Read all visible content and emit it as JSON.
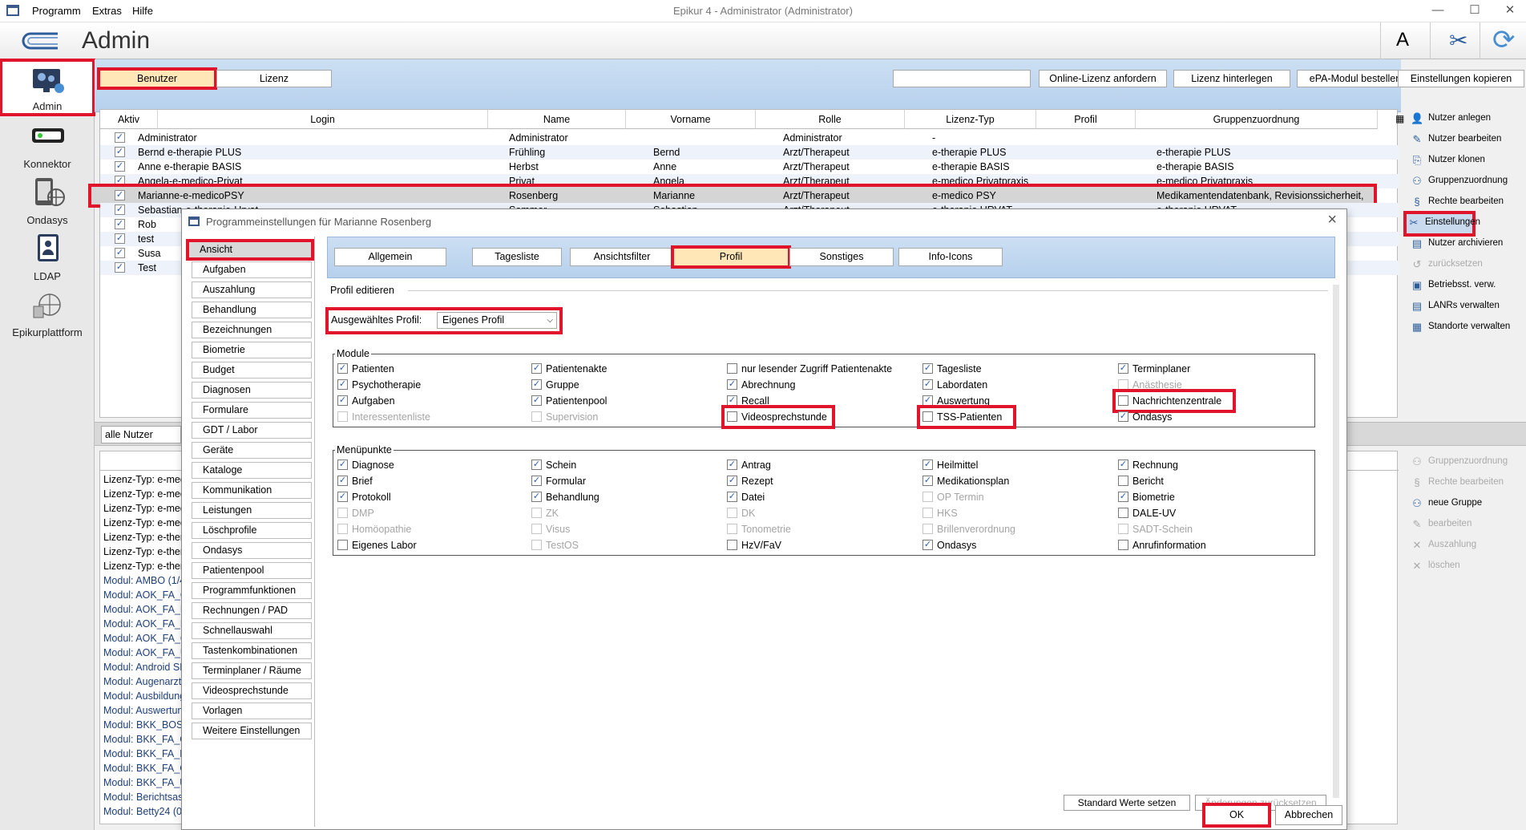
{
  "window": {
    "title": "Epikur 4 - Administrator (Administrator)",
    "menu": [
      "Programm",
      "Extras",
      "Hilfe"
    ]
  },
  "header": {
    "title": "Admin",
    "font_button": "A"
  },
  "nav": {
    "items": [
      {
        "label": "Admin",
        "icon": "admin-icon"
      },
      {
        "label": "Konnektor",
        "icon": "konnektor-icon"
      },
      {
        "label": "Ondasys",
        "icon": "ondasys-icon"
      },
      {
        "label": "LDAP",
        "icon": "ldap-icon"
      },
      {
        "label": "Epikurplattform",
        "icon": "platform-icon"
      }
    ]
  },
  "toolbar": {
    "tab_benutzer": "Benutzer",
    "tab_lizenz": "Lizenz",
    "search_value": "",
    "buttons": [
      "Online-Lizenz anfordern",
      "Lizenz hinterlegen",
      "ePA-Modul bestellen",
      "Einstellungen kopieren"
    ]
  },
  "table": {
    "columns": [
      "Aktiv",
      "Login",
      "Name",
      "Vorname",
      "Rolle",
      "Lizenz-Typ",
      "Profil",
      "Gruppenzuordnung"
    ],
    "rows": [
      {
        "login": "Administrator",
        "name": "Administrator",
        "vorname": "",
        "rolle": "Administrator",
        "lizenz": "-",
        "profil": "",
        "gruppe": ""
      },
      {
        "login": "Bernd e-therapie PLUS",
        "name": "Frühling",
        "vorname": "Bernd",
        "rolle": "Arzt/Therapeut",
        "lizenz": "e-therapie PLUS",
        "profil": "",
        "gruppe": "e-therapie PLUS"
      },
      {
        "login": "Anne e-therapie BASIS",
        "name": "Herbst",
        "vorname": "Anne",
        "rolle": "Arzt/Therapeut",
        "lizenz": "e-therapie BASIS",
        "profil": "",
        "gruppe": "e-therapie BASIS"
      },
      {
        "login": "Angela-e-medico-Privat",
        "name": "Privat",
        "vorname": "Angela",
        "rolle": "Arzt/Therapeut",
        "lizenz": "e-medico Privatpraxis",
        "profil": "",
        "gruppe": "e-medico Privatpraxis"
      },
      {
        "login": "Marianne-e-medicoPSY",
        "name": "Rosenberg",
        "vorname": "Marianne",
        "rolle": "Arzt/Therapeut",
        "lizenz": "e-medico PSY",
        "profil": "",
        "gruppe": "Medikamentendatenbank, Revisionssicherheit,"
      },
      {
        "login": "Sebastian-e-therapie-Urvat",
        "name": "Sommer",
        "vorname": "Sebastian",
        "rolle": "Arzt/Therapeut",
        "lizenz": "e-therapie URVAT",
        "profil": "",
        "gruppe": "e-therapie URVAT"
      },
      {
        "login": "Rob",
        "name": "",
        "vorname": "",
        "rolle": "",
        "lizenz": "",
        "profil": "",
        "gruppe": ""
      },
      {
        "login": "test",
        "name": "",
        "vorname": "",
        "rolle": "",
        "lizenz": "",
        "profil": "",
        "gruppe": ""
      },
      {
        "login": "Susa",
        "name": "",
        "vorname": "",
        "rolle": "",
        "lizenz": "",
        "profil": "",
        "gruppe": ""
      },
      {
        "login": "Test",
        "name": "",
        "vorname": "",
        "rolle": "",
        "lizenz": "",
        "profil": "",
        "gruppe": ""
      }
    ]
  },
  "actions": [
    {
      "label": "Nutzer anlegen",
      "icon": "user-add-icon",
      "enabled": true
    },
    {
      "label": "Nutzer bearbeiten",
      "icon": "user-edit-icon",
      "enabled": true
    },
    {
      "label": "Nutzer klonen",
      "icon": "user-clone-icon",
      "enabled": true
    },
    {
      "label": "Gruppenzuordnung",
      "icon": "group-icon",
      "enabled": true
    },
    {
      "label": "Rechte bearbeiten",
      "icon": "paragraph-icon",
      "enabled": true
    },
    {
      "label": "Einstellungen",
      "icon": "settings-icon",
      "enabled": true
    },
    {
      "label": "Nutzer archivieren",
      "icon": "archive-icon",
      "enabled": true
    },
    {
      "label": "zurücksetzen",
      "icon": "reset-icon",
      "enabled": false
    },
    {
      "label": "Betriebsst. verw.",
      "icon": "bsnr-icon",
      "enabled": true
    },
    {
      "label": "LANRs verwalten",
      "icon": "lanr-icon",
      "enabled": true
    },
    {
      "label": "Standorte verwalten",
      "icon": "location-icon",
      "enabled": true
    }
  ],
  "actions2": [
    {
      "label": "Gruppenzuordnung",
      "icon": "group-icon",
      "enabled": false
    },
    {
      "label": "Rechte bearbeiten",
      "icon": "paragraph-icon",
      "enabled": false
    },
    {
      "label": "neue Gruppe",
      "icon": "new-group-icon",
      "enabled": true
    },
    {
      "label": "bearbeiten",
      "icon": "edit-icon",
      "enabled": false
    },
    {
      "label": "Auszahlung",
      "icon": "payout-icon",
      "enabled": false
    },
    {
      "label": "löschen",
      "icon": "delete-icon",
      "enabled": false
    }
  ],
  "filter": {
    "value": "alle Nutzer"
  },
  "lower_list": [
    "Lizenz-Typ: e-med",
    "Lizenz-Typ: e-med",
    "Lizenz-Typ: e-med",
    "Lizenz-Typ: e-med",
    "Lizenz-Typ: e-thera",
    "Lizenz-Typ: e-thera",
    "Lizenz-Typ: e-thera",
    "Modul: AMBO (1/4(",
    "Modul: AOK_FA_G",
    "Modul: AOK_FA_K",
    "Modul: AOK_FA_N",
    "Modul: AOK_FA_C",
    "Modul: AOK_FA_U",
    "Modul: Android SM",
    "Modul: Augenarzt (",
    "Modul: Ausbildung",
    "Modul: Auswertun",
    "Modul: BKK_BOS(",
    "Modul: BKK_FA_G",
    "Modul: BKK_FA_K",
    "Modul: BKK_FA_C",
    "Modul: BKK_FA_U",
    "Modul: Berichtsas",
    "Modul: Betty24 (0/"
  ],
  "dialog": {
    "title": "Programmeinstellungen für Marianne Rosenberg",
    "categories": [
      "Ansicht",
      "Aufgaben",
      "Auszahlung",
      "Behandlung",
      "Bezeichnungen",
      "Biometrie",
      "Budget",
      "Diagnosen",
      "Formulare",
      "GDT / Labor",
      "Geräte",
      "Kataloge",
      "Kommunikation",
      "Leistungen",
      "Löschprofile",
      "Ondasys",
      "Patientenpool",
      "Programmfunktionen",
      "Rechnungen / PAD",
      "Schnellauswahl",
      "Tastenkombinationen",
      "Terminplaner / Räume",
      "Videosprechstunde",
      "Vorlagen",
      "Weitere Einstellungen"
    ],
    "tabs": [
      "Allgemein",
      "Tagesliste",
      "Ansichtsfilter",
      "Profil",
      "Sonstiges",
      "Info-Icons"
    ],
    "section_title": "Profil editieren",
    "profile_label": "Ausgewähltes Profil:",
    "profile_value": "Eigenes Profil",
    "modules_title": "Module",
    "modules": [
      [
        {
          "label": "Patienten",
          "checked": true,
          "enabled": true
        },
        {
          "label": "Psychotherapie",
          "checked": true,
          "enabled": true
        },
        {
          "label": "Aufgaben",
          "checked": true,
          "enabled": true
        },
        {
          "label": "Interessentenliste",
          "checked": false,
          "enabled": false
        }
      ],
      [
        {
          "label": "Patientenakte",
          "checked": true,
          "enabled": true
        },
        {
          "label": "Gruppe",
          "checked": true,
          "enabled": true
        },
        {
          "label": "Patientenpool",
          "checked": true,
          "enabled": true
        },
        {
          "label": "Supervision",
          "checked": false,
          "enabled": false
        }
      ],
      [
        {
          "label": "nur lesender Zugriff Patientenakte",
          "checked": false,
          "enabled": true
        },
        {
          "label": "Abrechnung",
          "checked": true,
          "enabled": true
        },
        {
          "label": "Recall",
          "checked": true,
          "enabled": true
        },
        {
          "label": "Videosprechstunde",
          "checked": false,
          "enabled": true
        }
      ],
      [
        {
          "label": "Tagesliste",
          "checked": true,
          "enabled": true
        },
        {
          "label": "Labordaten",
          "checked": true,
          "enabled": true
        },
        {
          "label": "Auswertung",
          "checked": true,
          "enabled": true
        },
        {
          "label": "TSS-Patienten",
          "checked": false,
          "enabled": true
        }
      ],
      [
        {
          "label": "Terminplaner",
          "checked": true,
          "enabled": true
        },
        {
          "label": "Anästhesie",
          "checked": false,
          "enabled": false
        },
        {
          "label": "Nachrichtenzentrale",
          "checked": false,
          "enabled": true
        },
        {
          "label": "Ondasys",
          "checked": true,
          "enabled": true
        }
      ]
    ],
    "menu_title": "Menüpunkte",
    "menu": [
      [
        {
          "label": "Diagnose",
          "checked": true,
          "enabled": true
        },
        {
          "label": "Brief",
          "checked": true,
          "enabled": true
        },
        {
          "label": "Protokoll",
          "checked": true,
          "enabled": true
        },
        {
          "label": "DMP",
          "checked": false,
          "enabled": false
        },
        {
          "label": "Homöopathie",
          "checked": false,
          "enabled": false
        },
        {
          "label": "Eigenes Labor",
          "checked": false,
          "enabled": true
        }
      ],
      [
        {
          "label": "Schein",
          "checked": true,
          "enabled": true
        },
        {
          "label": "Formular",
          "checked": true,
          "enabled": true
        },
        {
          "label": "Behandlung",
          "checked": true,
          "enabled": true
        },
        {
          "label": "ZK",
          "checked": false,
          "enabled": false
        },
        {
          "label": "Visus",
          "checked": false,
          "enabled": false
        },
        {
          "label": "TestOS",
          "checked": false,
          "enabled": false
        }
      ],
      [
        {
          "label": "Antrag",
          "checked": true,
          "enabled": true
        },
        {
          "label": "Rezept",
          "checked": true,
          "enabled": true
        },
        {
          "label": "Datei",
          "checked": true,
          "enabled": true
        },
        {
          "label": "DK",
          "checked": false,
          "enabled": false
        },
        {
          "label": "Tonometrie",
          "checked": false,
          "enabled": false
        },
        {
          "label": "HzV/FaV",
          "checked": false,
          "enabled": true
        }
      ],
      [
        {
          "label": "Heilmittel",
          "checked": true,
          "enabled": true
        },
        {
          "label": "Medikationsplan",
          "checked": true,
          "enabled": true
        },
        {
          "label": "OP Termin",
          "checked": false,
          "enabled": false
        },
        {
          "label": "HKS",
          "checked": false,
          "enabled": false
        },
        {
          "label": "Brillenverordnung",
          "checked": false,
          "enabled": false
        },
        {
          "label": "Ondasys",
          "checked": true,
          "enabled": true
        }
      ],
      [
        {
          "label": "Rechnung",
          "checked": true,
          "enabled": true
        },
        {
          "label": "Bericht",
          "checked": false,
          "enabled": true
        },
        {
          "label": "Biometrie",
          "checked": true,
          "enabled": true
        },
        {
          "label": "DALE-UV",
          "checked": false,
          "enabled": true
        },
        {
          "label": "SADT-Schein",
          "checked": false,
          "enabled": false
        },
        {
          "label": "Anrufinformation",
          "checked": false,
          "enabled": true
        }
      ]
    ],
    "btn_defaults": "Standard Werte setzen",
    "btn_reset": "Änderungen zurücksetzen",
    "btn_ok": "OK",
    "btn_cancel": "Abbrechen"
  }
}
